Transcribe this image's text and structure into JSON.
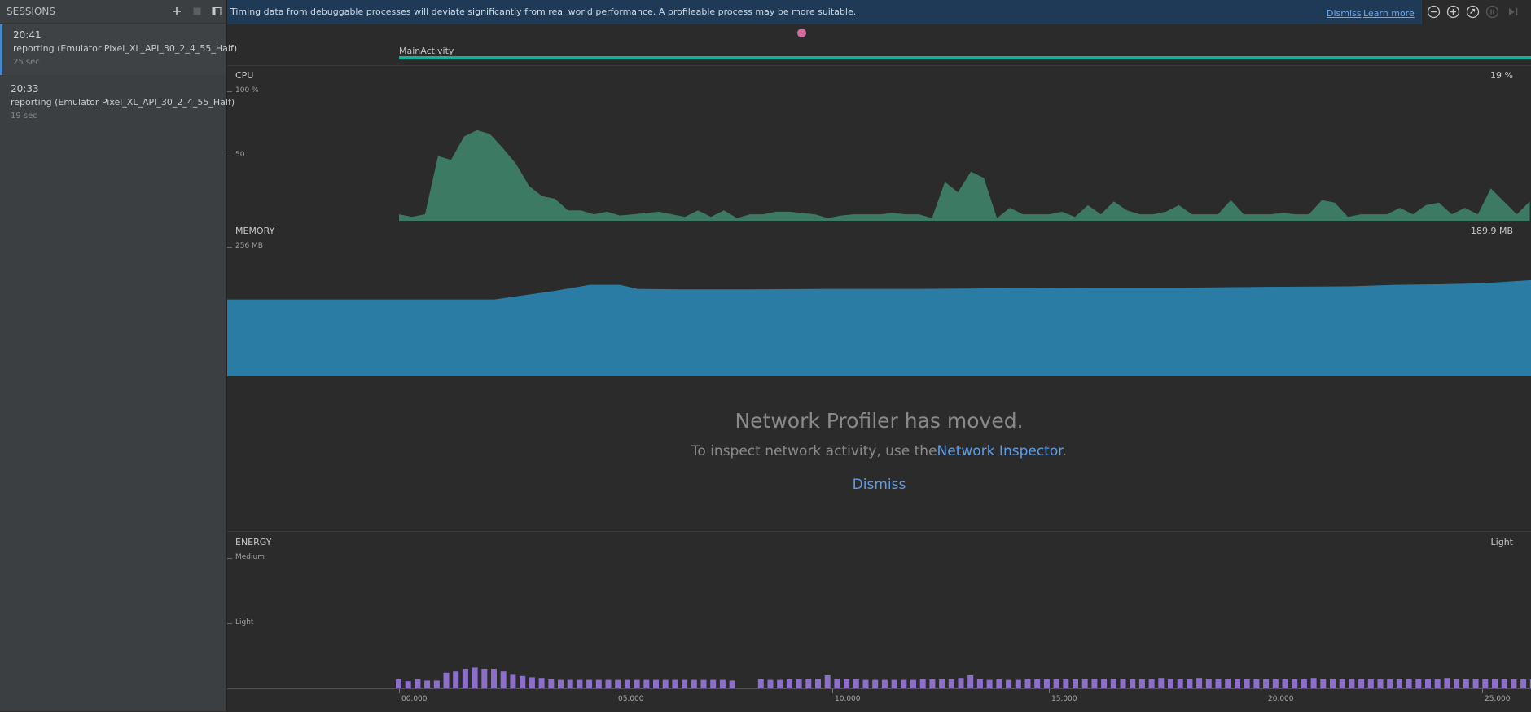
{
  "sessions": {
    "title": "SESSIONS",
    "items": [
      {
        "time": "20:41",
        "name": "reporting (Emulator Pixel_XL_API_30_2_4_55_Half)",
        "duration": "25 sec"
      },
      {
        "time": "20:33",
        "name": "reporting (Emulator Pixel_XL_API_30_2_4_55_Half)",
        "duration": "19 sec"
      }
    ]
  },
  "banner": {
    "text": "Timing data from debuggable processes will deviate significantly from real world performance. A profileable process may be more suitable.",
    "dismiss": "Dismiss",
    "learn_more": "Learn more"
  },
  "events": {
    "activity": "MainActivity"
  },
  "cpu": {
    "label": "CPU",
    "value": "19 %",
    "axis_top": "100 %",
    "axis_mid": "50",
    "color": "#3d7a63"
  },
  "memory": {
    "label": "MEMORY",
    "value": "189,9 MB",
    "axis_top": "256 MB",
    "axis_mid": "128",
    "color": "#2a7ca5"
  },
  "network": {
    "title": "Network Profiler has moved.",
    "message": "To inspect network activity, use the",
    "link": "Network Inspector",
    "period": ".",
    "dismiss": "Dismiss"
  },
  "energy": {
    "label": "ENERGY",
    "value": "Light",
    "axis_top": "Medium",
    "axis_mid": "Light",
    "color": "#8b6fc9"
  },
  "timeline": {
    "labels": [
      "00.000",
      "05.000",
      "10.000",
      "15.000",
      "20.000",
      "25.000"
    ]
  },
  "chart_data": [
    {
      "type": "area",
      "title": "CPU",
      "ylabel": "%",
      "ylim": [
        0,
        100
      ],
      "x": [
        0,
        0.3,
        0.6,
        0.9,
        1.2,
        1.5,
        1.8,
        2.1,
        2.4,
        2.7,
        3.0,
        3.3,
        3.6,
        3.9,
        4.2,
        4.5,
        4.8,
        5.1,
        5.4,
        5.7,
        6.0,
        6.3,
        6.6,
        6.9,
        7.2,
        7.5,
        7.8,
        8.1,
        8.4,
        8.7,
        9.0,
        9.3,
        9.6,
        9.9,
        10.2,
        10.5,
        10.8,
        11.1,
        11.4,
        11.7,
        12.0,
        12.3,
        12.6,
        12.9,
        13.2,
        13.5,
        13.8,
        14.1,
        14.4,
        14.7,
        15.0,
        15.3,
        15.6,
        15.9,
        16.2,
        16.5,
        16.8,
        17.1,
        17.4,
        17.7,
        18.0,
        18.3,
        18.6,
        18.9,
        19.2,
        19.5,
        19.8,
        20.1,
        20.4,
        20.7,
        21.0,
        21.3,
        21.6,
        21.9,
        22.2,
        22.5,
        22.8,
        23.1,
        23.4,
        23.7,
        24.0,
        24.3,
        24.6,
        24.9,
        25.2,
        25.5,
        25.8,
        26.1
      ],
      "values": [
        5,
        3,
        5,
        50,
        47,
        65,
        70,
        67,
        56,
        44,
        27,
        19,
        17,
        8,
        8,
        5,
        7,
        4,
        5,
        6,
        7,
        5,
        3,
        8,
        3,
        8,
        2,
        5,
        5,
        7,
        7,
        6,
        5,
        2,
        4,
        5,
        5,
        5,
        6,
        5,
        5,
        2,
        30,
        22,
        38,
        33,
        2,
        10,
        5,
        5,
        5,
        7,
        3,
        12,
        5,
        15,
        8,
        5,
        5,
        7,
        12,
        5,
        5,
        5,
        16,
        5,
        5,
        5,
        6,
        5,
        5,
        16,
        14,
        3,
        5,
        5,
        5,
        10,
        5,
        12,
        14,
        5,
        10,
        5,
        25,
        15,
        5,
        15,
        10,
        5,
        5,
        20,
        5,
        5,
        5,
        30,
        5,
        8,
        2,
        8,
        12,
        8,
        10,
        36,
        8,
        5,
        14,
        8,
        13,
        5,
        17,
        28,
        50,
        10,
        13,
        13,
        13,
        13
      ],
      "value_label": "19 %"
    },
    {
      "type": "area",
      "title": "MEMORY",
      "ylabel": "MB",
      "ylim": [
        0,
        256
      ],
      "x": [
        0,
        2.2,
        3.6,
        4.4,
        5.1,
        5.5,
        6.5,
        8,
        10,
        12,
        14,
        16,
        18,
        20,
        22,
        23,
        24,
        25,
        26.1
      ],
      "values": [
        152,
        152,
        169,
        181,
        181,
        173,
        172,
        172,
        173,
        173,
        174,
        175,
        175,
        177,
        178,
        181,
        182,
        184,
        190
      ],
      "value_label": "189,9 MB"
    },
    {
      "type": "bar",
      "title": "ENERGY",
      "ylim": [
        0,
        2
      ],
      "yticks": [
        "Light",
        "Medium"
      ],
      "x_start": 0,
      "x_step": 0.22,
      "values": [
        0.14,
        0.11,
        0.14,
        0.12,
        0.12,
        0.24,
        0.26,
        0.3,
        0.32,
        0.3,
        0.3,
        0.26,
        0.22,
        0.19,
        0.17,
        0.16,
        0.14,
        0.13,
        0.13,
        0.13,
        0.13,
        0.13,
        0.13,
        0.13,
        0.13,
        0.13,
        0.13,
        0.13,
        0.13,
        0.13,
        0.13,
        0.13,
        0.13,
        0.13,
        0.13,
        0.12,
        0.12,
        0.13,
        0.14,
        0.13,
        0.13,
        0.14,
        0.14,
        0.15,
        0.15,
        0.2,
        0.14,
        0.14,
        0.14,
        0.13,
        0.13,
        0.13,
        0.13,
        0.13,
        0.13,
        0.14,
        0.14,
        0.14,
        0.14,
        0.16,
        0.2,
        0.14,
        0.13,
        0.14,
        0.13,
        0.13,
        0.14,
        0.14,
        0.14,
        0.14,
        0.14,
        0.14,
        0.14,
        0.15,
        0.15,
        0.15,
        0.15,
        0.14,
        0.14,
        0.14,
        0.16,
        0.14,
        0.14,
        0.14,
        0.16,
        0.14,
        0.14,
        0.14,
        0.14,
        0.14,
        0.14,
        0.14,
        0.14,
        0.14,
        0.14,
        0.14,
        0.16,
        0.14,
        0.14,
        0.14,
        0.15,
        0.14,
        0.14,
        0.14,
        0.14,
        0.15,
        0.14,
        0.14,
        0.14,
        0.14,
        0.16,
        0.14,
        0.14,
        0.14,
        0.14,
        0.14,
        0.15,
        0.14,
        0.14,
        0.14,
        0.18,
        0.14,
        0.14,
        0.14,
        0.14,
        0.14,
        0.14,
        0.14,
        0.14,
        0.14,
        0.14,
        0.16,
        0.14,
        0.14,
        0.14,
        0.16,
        0.14,
        0.14,
        0.14,
        0.14,
        0.14,
        0.14,
        0.14,
        0.14,
        0.14,
        0.14,
        0.14,
        0.14,
        0.15,
        0.15,
        0.14,
        0.14,
        0.16,
        0.14,
        0.14,
        0.14,
        0.2,
        0.16,
        0.15,
        0.14,
        0.15,
        0.16,
        0.14,
        0.14,
        0.14,
        0.14,
        0.14,
        0.16,
        0.14,
        0.22,
        0.14
      ],
      "value_label": "Light"
    }
  ]
}
